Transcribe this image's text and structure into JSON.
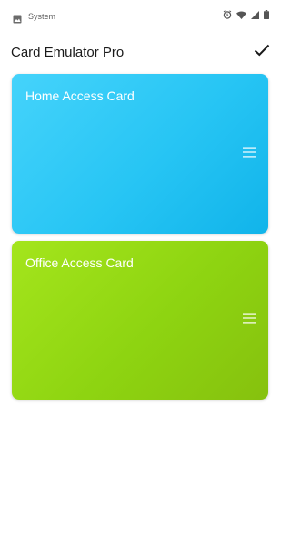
{
  "status_bar": {
    "label": "System",
    "icons": [
      "image-icon",
      "alarm-icon",
      "wifi-icon",
      "signal-icon",
      "battery-icon"
    ]
  },
  "app_bar": {
    "title": "Card Emulator Pro",
    "action_icon": "checkmark-icon"
  },
  "cards": [
    {
      "name": "Home Access Card",
      "color_start": "#45d3fb",
      "color_end": "#11b4ea",
      "menu_icon": "menu-icon"
    },
    {
      "name": "Office Access Card",
      "color_start": "#a4e51c",
      "color_end": "#86c10e",
      "menu_icon": "menu-icon"
    }
  ]
}
